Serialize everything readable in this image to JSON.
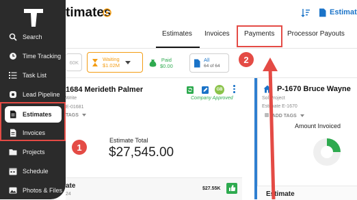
{
  "header": {
    "title_partial": "timates",
    "right_label_partial": "Estimate"
  },
  "sidebar": {
    "items": [
      {
        "label": "Search",
        "icon": "search-icon"
      },
      {
        "label": "Time Tracking",
        "icon": "clock-icon"
      },
      {
        "label": "Task List",
        "icon": "list-icon"
      },
      {
        "label": "Lead Pipeline",
        "icon": "dollar-icon"
      },
      {
        "label": "Estimates",
        "icon": "document-icon",
        "active": true
      },
      {
        "label": "Invoices",
        "icon": "invoice-icon"
      },
      {
        "label": "Projects",
        "icon": "folder-icon"
      },
      {
        "label": "Schedule",
        "icon": "calendar-icon"
      },
      {
        "label": "Photos & Files",
        "icon": "photo-icon"
      }
    ]
  },
  "tabs": [
    {
      "label": "Estimates",
      "active": true
    },
    {
      "label": "Invoices"
    },
    {
      "label": "Payments",
      "highlighted": true
    },
    {
      "label": "Processor Payouts"
    }
  ],
  "filters": {
    "partial_value": "60K",
    "waiting": {
      "label": "Waiting",
      "value": "$1.02M"
    },
    "paid": {
      "label": "Paid",
      "value": "$0.00"
    },
    "all": {
      "label": "All",
      "count": "64 of 64"
    }
  },
  "annotations": {
    "step1": "1",
    "step2": "2"
  },
  "card_left": {
    "title": "1684 Merideth Palmer",
    "subtitle": "Write",
    "number": "E-01681",
    "tags_label": "TAGS",
    "avatar_initials": "GB",
    "status": "Company Approved",
    "total_label": "Estimate Total",
    "total_value": "$27,545.00",
    "footer_label": "ate",
    "footer_sub": "24",
    "footer_amount": "$27.55K"
  },
  "card_right": {
    "title": "P-1670 Bruce Wayne",
    "type": "Sol Project",
    "number": "Estimate E-1670",
    "tags_label": "ADD TAGS",
    "amount_label": "Amount Invoiced",
    "footer_label": "Estimate"
  },
  "colors": {
    "sidebar": "#2b2b2b",
    "accent_red": "#e44b45",
    "brand_orange": "#f39c12",
    "blue": "#1a73c8",
    "green": "#2eaa4f"
  }
}
